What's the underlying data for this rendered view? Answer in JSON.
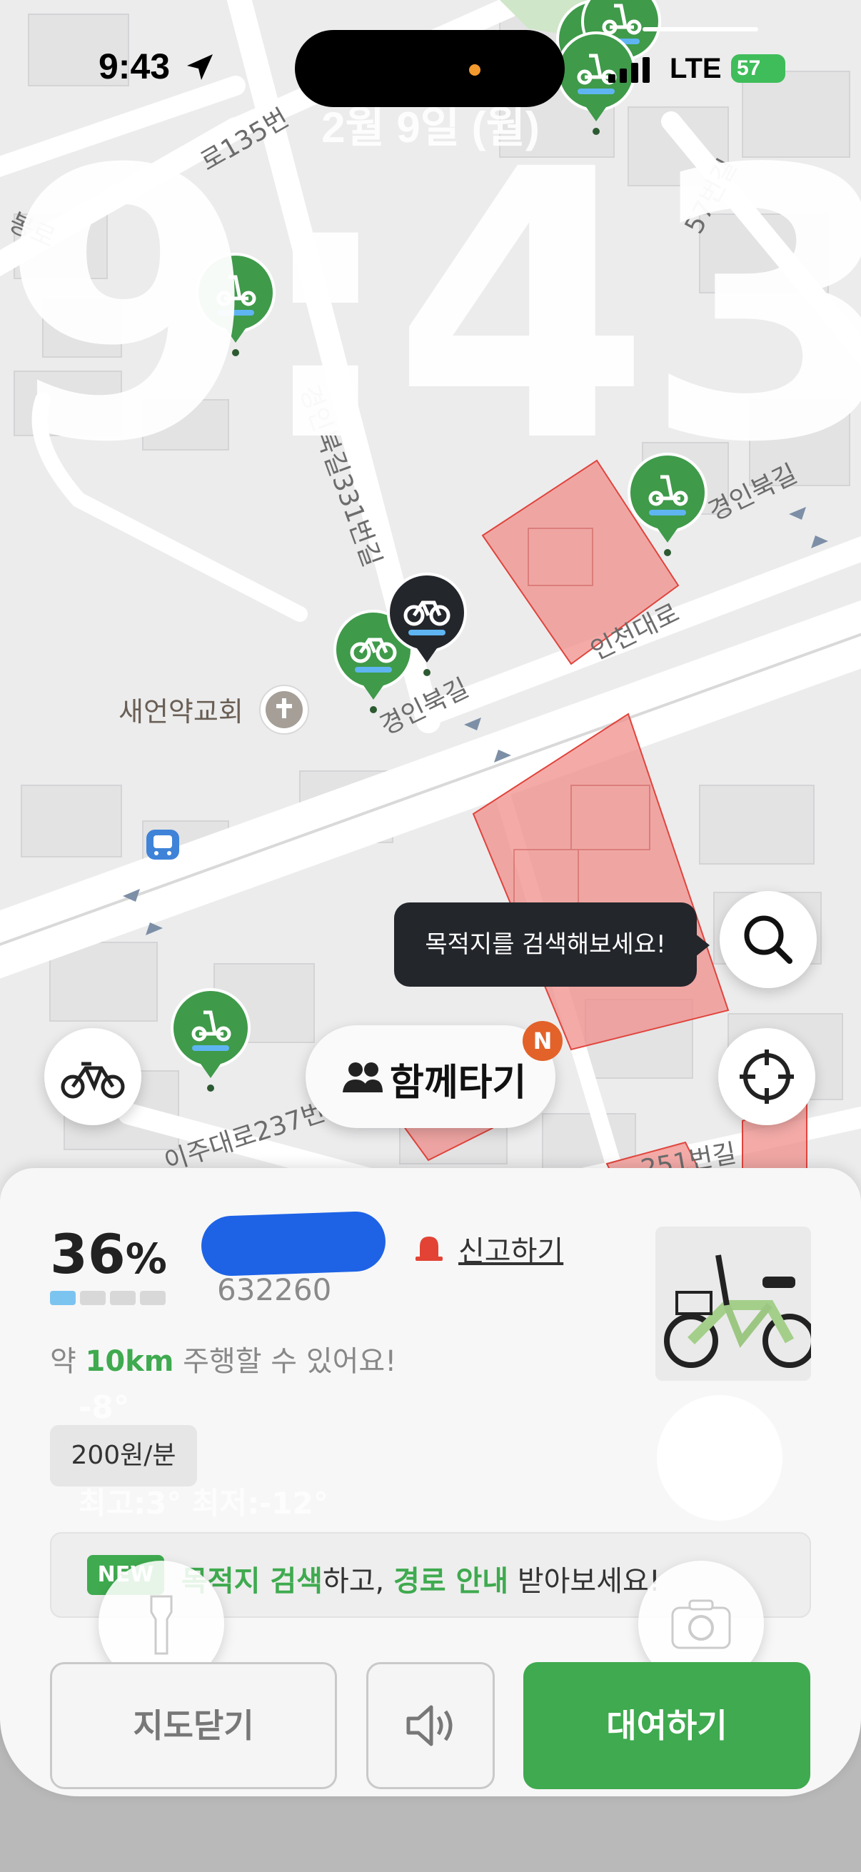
{
  "status_bar": {
    "time": "9:43",
    "network": "LTE",
    "battery": "57"
  },
  "lock_screen": {
    "date": "2월 9일 (월)",
    "clock": "9:43"
  },
  "map": {
    "street_labels": [
      "봉로",
      "로135번",
      "57번길",
      "경인북길331번길",
      "경인북길",
      "인천대로",
      "경인북길",
      "이주대로237번",
      "251번길"
    ],
    "place_label": "새언약교회"
  },
  "tooltip": {
    "text": "목적지를 검색해보세요!"
  },
  "ride_together": {
    "label": "함께타기",
    "badge": "N"
  },
  "bike": {
    "battery_percent": "36",
    "percent_sign": "%",
    "battery_level": 0.36,
    "bike_id": "632260",
    "report_label": "신고하기",
    "range_prefix": "약 ",
    "range_value": "10km",
    "range_suffix": " 주행할 수 있어요!",
    "price": "200원/분"
  },
  "weather_widget": {
    "temp": "-8°",
    "high_low": "최고:3° 최저:-12°"
  },
  "promo": {
    "badge": "NEW",
    "part1": "목적지 검색",
    "part2": "하고, ",
    "part3": "경로 안내",
    "part4": " 받아보세요!"
  },
  "actions": {
    "close_map": "지도닫기",
    "rent": "대여하기"
  },
  "colors": {
    "brand_green": "#3faa4f",
    "pin_green": "#3f9a4a",
    "zone_red": "#f08a86",
    "tooltip_bg": "#23262b",
    "badge_orange": "#e2622a"
  },
  "icons": [
    "location-arrow-icon",
    "signal-icon",
    "battery-icon",
    "bike-pin-icon",
    "scooter-pin-icon",
    "church-icon",
    "bus-stop-icon",
    "search-icon",
    "target-icon",
    "people-icon",
    "bike-toggle-icon",
    "siren-icon",
    "flashlight-icon",
    "camera-icon",
    "speaker-icon"
  ]
}
